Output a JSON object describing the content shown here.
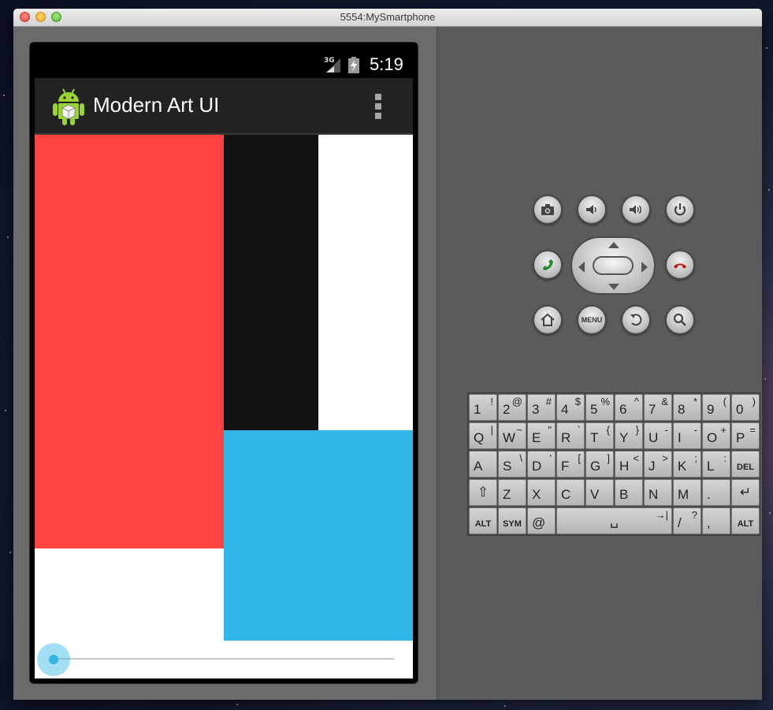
{
  "window": {
    "title": "5554:MySmartphone"
  },
  "status_bar": {
    "network": "3G",
    "time": "5:19"
  },
  "action_bar": {
    "title": "Modern Art UI",
    "overflow_icon": "overflow-menu-icon"
  },
  "art_blocks": [
    {
      "name": "red-block",
      "color": "#ff4340"
    },
    {
      "name": "black-block",
      "color": "#111111"
    },
    {
      "name": "white-block-top-right",
      "color": "#ffffff"
    },
    {
      "name": "white-block-bottom-left",
      "color": "#ffffff"
    },
    {
      "name": "blue-block",
      "color": "#32b5e7"
    },
    {
      "name": "white-strip-bottom",
      "color": "#ffffff"
    }
  ],
  "seekbar": {
    "progress": 0,
    "accent": "#33b5e5"
  },
  "hardware_buttons": {
    "row1": [
      "camera-icon",
      "volume-down-icon",
      "volume-up-icon",
      "power-icon"
    ],
    "row2": [
      "call-icon",
      "dpad",
      "end-call-icon"
    ],
    "row3": [
      "home-icon",
      "menu-button",
      "back-icon",
      "search-icon"
    ],
    "menu_label": "MENU"
  },
  "keyboard": {
    "row1": [
      {
        "main": "1",
        "sub": "!"
      },
      {
        "main": "2",
        "sub": "@"
      },
      {
        "main": "3",
        "sub": "#"
      },
      {
        "main": "4",
        "sub": "$"
      },
      {
        "main": "5",
        "sub": "%"
      },
      {
        "main": "6",
        "sub": "^"
      },
      {
        "main": "7",
        "sub": "&"
      },
      {
        "main": "8",
        "sub": "*"
      },
      {
        "main": "9",
        "sub": "("
      },
      {
        "main": "0",
        "sub": ")"
      }
    ],
    "row2": [
      {
        "main": "Q",
        "sub": "|"
      },
      {
        "main": "W",
        "sub": "~"
      },
      {
        "main": "E",
        "sub": "\""
      },
      {
        "main": "R",
        "sub": "`"
      },
      {
        "main": "T",
        "sub": "{"
      },
      {
        "main": "Y",
        "sub": "}"
      },
      {
        "main": "U",
        "sub": "-"
      },
      {
        "main": "I",
        "sub": "-"
      },
      {
        "main": "O",
        "sub": "+"
      },
      {
        "main": "P",
        "sub": "="
      }
    ],
    "row3": [
      {
        "main": "A",
        "sub": ""
      },
      {
        "main": "S",
        "sub": "\\"
      },
      {
        "main": "D",
        "sub": "'"
      },
      {
        "main": "F",
        "sub": "["
      },
      {
        "main": "G",
        "sub": "]"
      },
      {
        "main": "H",
        "sub": "<"
      },
      {
        "main": "J",
        "sub": ">"
      },
      {
        "main": "K",
        "sub": ";"
      },
      {
        "main": "L",
        "sub": ":"
      },
      {
        "main": "DEL",
        "sub": ""
      }
    ],
    "row4": [
      {
        "main": "⇧",
        "sub": ""
      },
      {
        "main": "Z",
        "sub": ""
      },
      {
        "main": "X",
        "sub": ""
      },
      {
        "main": "C",
        "sub": ""
      },
      {
        "main": "V",
        "sub": ""
      },
      {
        "main": "B",
        "sub": ""
      },
      {
        "main": "N",
        "sub": ""
      },
      {
        "main": "M",
        "sub": ""
      },
      {
        "main": ".",
        "sub": ""
      },
      {
        "main": "↵",
        "sub": ""
      }
    ],
    "row5": [
      {
        "main": "ALT",
        "sub": ""
      },
      {
        "main": "SYM",
        "sub": ""
      },
      {
        "main": "@",
        "sub": ""
      },
      {
        "main": "␣",
        "sub": "→|"
      },
      {
        "main": "/",
        "sub": "?"
      },
      {
        "main": ",",
        "sub": ""
      },
      {
        "main": "ALT",
        "sub": ""
      }
    ]
  }
}
